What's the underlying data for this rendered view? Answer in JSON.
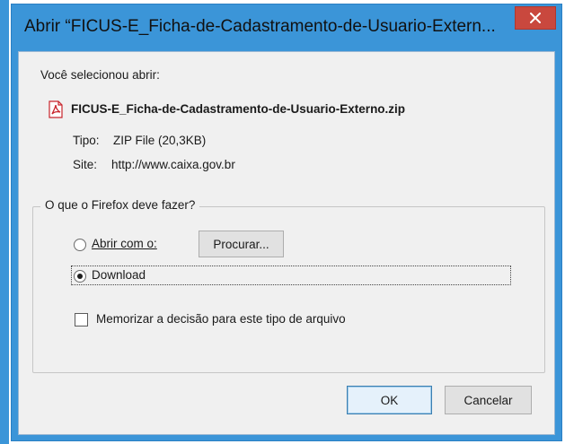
{
  "dialog": {
    "title": "Abrir “FICUS-E_Ficha-de-Cadastramento-de-Usuario-Extern...",
    "intro": "Você selecionou abrir:",
    "file_name": "FICUS-E_Ficha-de-Cadastramento-de-Usuario-Externo.zip",
    "file_icon": "pdf-file-icon",
    "type_label": "Tipo:",
    "type_value": "ZIP File (20,3KB)",
    "site_label": "Site:",
    "site_value": "http://www.caixa.gov.br",
    "group_title": "O que o Firefox deve fazer?",
    "open_with_label": "Abrir com o:",
    "browse_label": "Procurar...",
    "download_label": "Download",
    "remember_label": "Memorizar a decisão para este tipo de arquivo",
    "ok_label": "OK",
    "cancel_label": "Cancelar",
    "selected_option": "download",
    "remember_checked": false
  },
  "colors": {
    "frame": "#3b95d8",
    "close": "#c9483e",
    "client": "#f0f0f0"
  }
}
